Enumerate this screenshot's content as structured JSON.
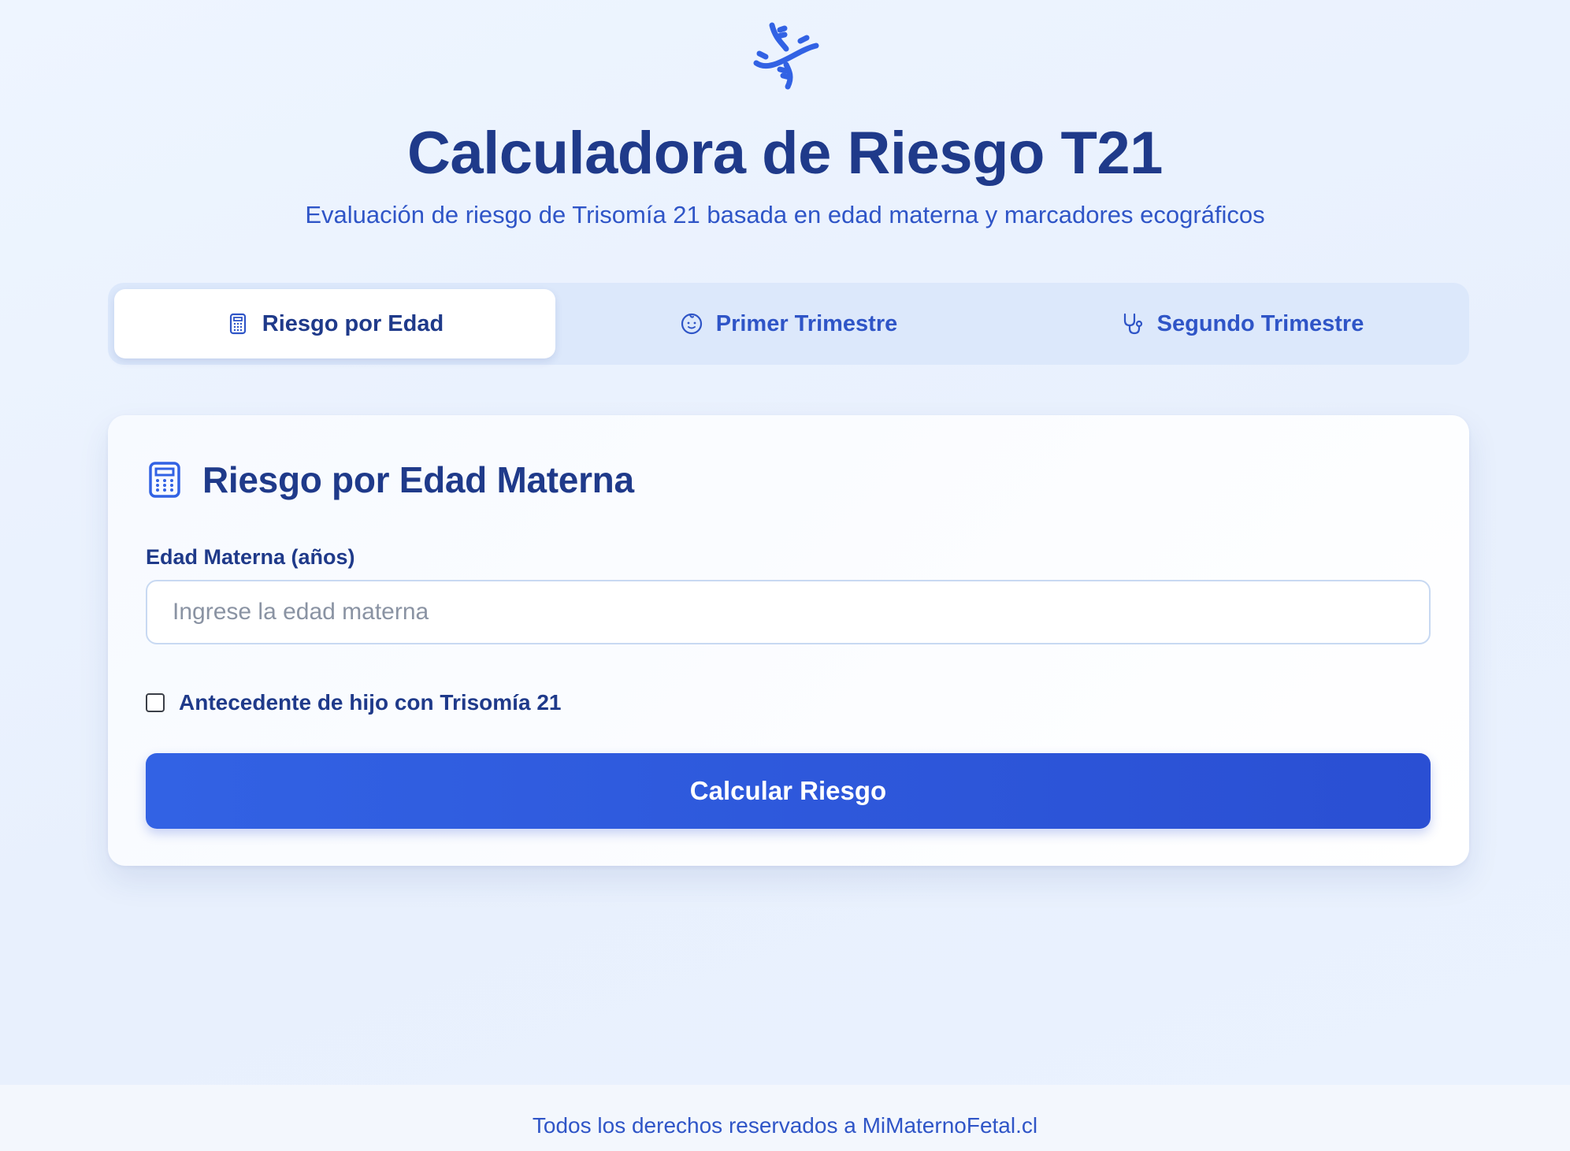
{
  "header": {
    "logo_icon": "dna-icon",
    "title": "Calculadora de Riesgo T21",
    "subtitle": "Evaluación de riesgo de Trisomía 21 basada en edad materna y marcadores ecográficos"
  },
  "tabs": [
    {
      "label": "Riesgo por Edad",
      "icon": "calculator-icon",
      "active": true
    },
    {
      "label": "Primer Trimestre",
      "icon": "baby-face-icon",
      "active": false
    },
    {
      "label": "Segundo Trimestre",
      "icon": "stethoscope-icon",
      "active": false
    }
  ],
  "card": {
    "icon": "calculator-icon",
    "title": "Riesgo por Edad Materna",
    "age_field": {
      "label": "Edad Materna (años)",
      "placeholder": "Ingrese la edad materna",
      "value": ""
    },
    "history_checkbox": {
      "label": "Antecedente de hijo con Trisomía 21",
      "checked": false
    },
    "calculate_button": "Calcular Riesgo"
  },
  "footer": {
    "text": "Todos los derechos reservados a MiMaternoFetal.cl"
  },
  "colors": {
    "primary": "#2a4fd3",
    "heading": "#1f3a8a",
    "accent_text": "#2f55c7",
    "tab_bar_bg": "#dce8fb",
    "page_bg": "#eaf2fe"
  }
}
